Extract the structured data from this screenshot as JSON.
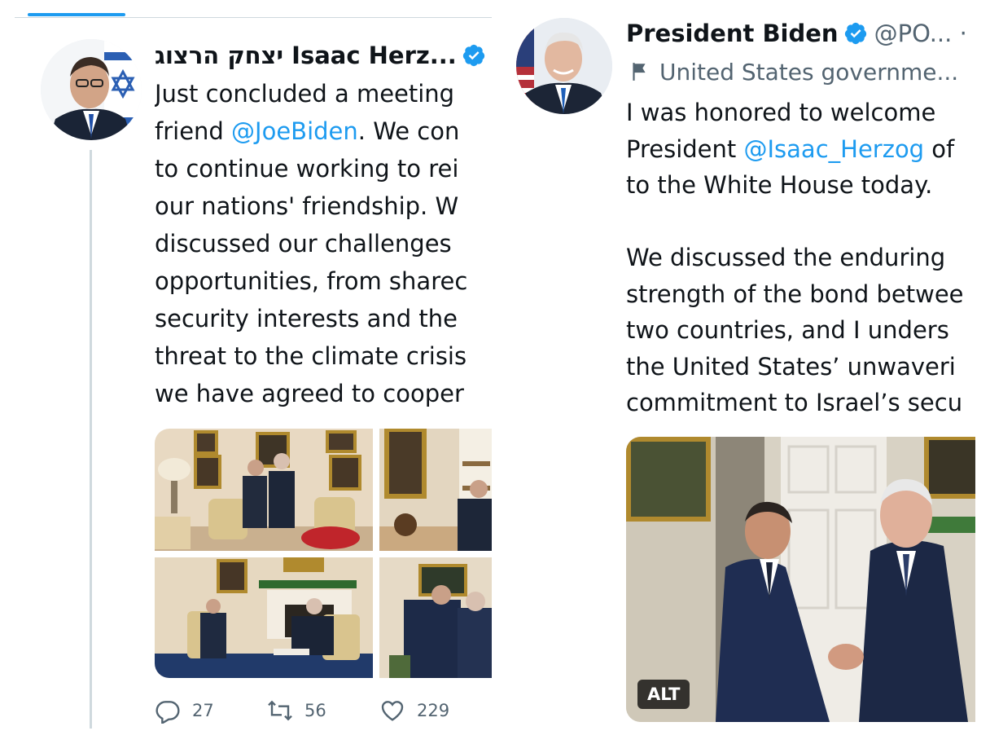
{
  "left_tweet": {
    "display_name": "יצחק הרצוג Isaac Herz...",
    "text_lines": [
      "Just concluded a meeting",
      "friend ",
      "to continue working to rei",
      "our nations' friendship. W",
      "discussed our challenges",
      "opportunities, from sharec",
      "security interests and the",
      "threat to the climate crisis",
      "we have agreed to cooper"
    ],
    "mention": "@JoeBiden",
    "mention_suffix": ". We con",
    "actions": {
      "replies": "27",
      "retweets": "56",
      "likes": "229"
    }
  },
  "right_tweet": {
    "display_name": "President Biden",
    "handle": "@PO... ·",
    "label": "United States governme...",
    "text_line_1": "I was honored to welcome",
    "text_line_2_prefix": "President ",
    "mention": "@Isaac_Herzog",
    "text_line_2_suffix": " of",
    "text_line_3": "to the White House today.",
    "text_lines_rest": [
      "We discussed the enduring",
      "strength of the bond betwee",
      "two countries, and I unders",
      "the United States’ unwaveri",
      "commitment to Israel’s secu"
    ],
    "alt_badge": "ALT"
  },
  "colors": {
    "accent": "#1d9bf0",
    "text": "#0f1419",
    "muted": "#536471"
  },
  "icons": [
    "verified-badge-icon",
    "reply-icon",
    "retweet-icon",
    "like-icon",
    "government-flag-icon"
  ]
}
